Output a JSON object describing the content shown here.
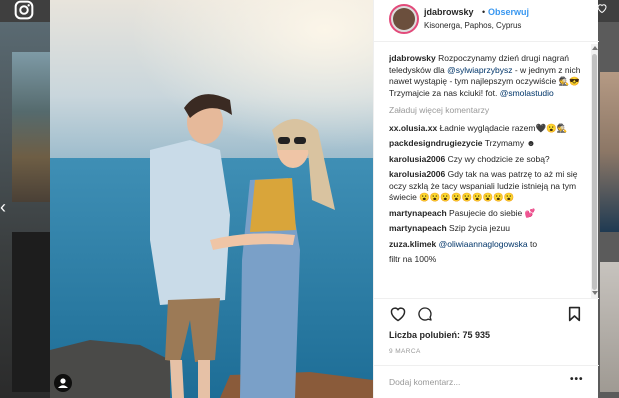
{
  "post": {
    "username": "jdabrowsky",
    "separator": "•",
    "follow_label": "Obserwuj",
    "location": "Kisonerga, Paphos, Cyprus"
  },
  "caption": {
    "username": "jdabrowsky",
    "text_1": "Rozpoczynamy dzień drugi nagrań teledysków dla",
    "mention_1": "@sylwiaprzybysz",
    "text_2": "- w jednym z nich nawet wystąpię - tym najlepszym oczywiście 🕵️😎 Trzymajcie za nas kciuki! fot.",
    "mention_2": "@smolastudio"
  },
  "load_more": "Załaduj więcej komentarzy",
  "comments": [
    {
      "username": "xx.olusia.xx",
      "text": "Ładnie wyglądacie razem🖤😮🕵️"
    },
    {
      "username": "packdesigndrugiezycie",
      "text": "Trzymamy ☻"
    },
    {
      "username": "karolusia2006",
      "text": "Czy wy chodzicie ze sobą?"
    },
    {
      "username": "karolusia2006",
      "text": "Gdy tak na was patrzę to aż mi się oczy szklą że tacy wspaniali ludzie istnieją na tym świecie 😮😮😮😮😮😮😮😮😮"
    },
    {
      "username": "martynapeach",
      "text": "Pasujecie do siebie 💕"
    },
    {
      "username": "martynapeach",
      "text": "Szip życia jezuu"
    },
    {
      "username": "zuza.klimek",
      "mention": "@oliwiaannaglogowska",
      "text": "to"
    },
    {
      "username": "",
      "text": "filtr na 100%"
    }
  ],
  "likes_label": "Liczba polubień: 75 935",
  "date": "9 MARCA",
  "add_comment_placeholder": "Dodaj komentarz...",
  "more_options": "•••",
  "icons": {
    "instagram": "instagram-icon",
    "heart": "heart-icon",
    "comment": "comment-bubble-icon",
    "save": "bookmark-icon",
    "user_tag": "user-tag-icon",
    "prev": "chevron-left-icon"
  },
  "colors": {
    "link": "#3897f0",
    "mention": "#003569",
    "muted": "#999999"
  }
}
